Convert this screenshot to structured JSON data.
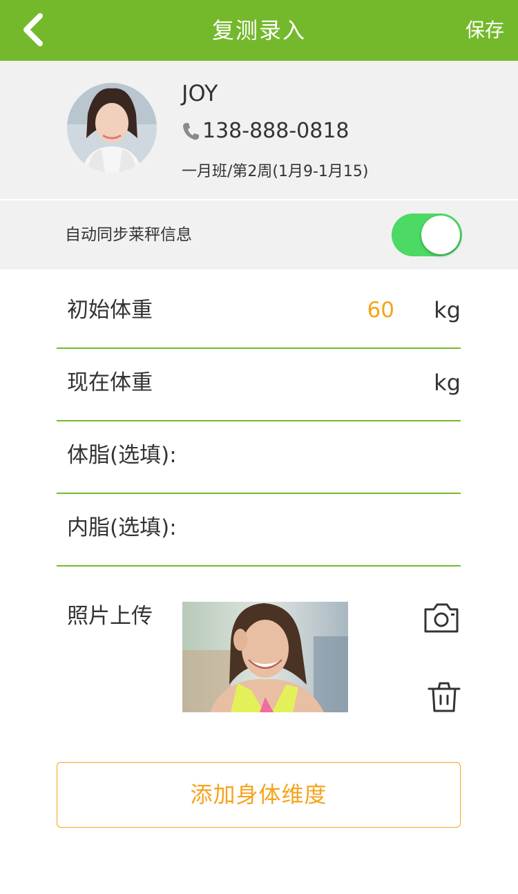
{
  "header": {
    "title": "复测录入",
    "save_label": "保存",
    "back_icon": "chevron-left-icon"
  },
  "profile": {
    "name": "JOY",
    "phone": "138-888-0818",
    "class_info": "一月班/第2周(1月9-1月15)"
  },
  "sync": {
    "label": "自动同步莱秤信息",
    "enabled": true
  },
  "form": {
    "initial_weight": {
      "label": "初始体重",
      "value": "60",
      "unit": "kg"
    },
    "current_weight": {
      "label": "现在体重",
      "value": "",
      "unit": "kg"
    },
    "body_fat": {
      "label": "体脂(选填):"
    },
    "visceral_fat": {
      "label": "内脂(选填):"
    }
  },
  "photo": {
    "label": "照片上传"
  },
  "add_dimension_label": "添加身体维度",
  "colors": {
    "primary": "#74b92c",
    "accent": "#f5a31c",
    "toggle_on": "#4cd964",
    "section_bg": "#f1f1f1"
  }
}
